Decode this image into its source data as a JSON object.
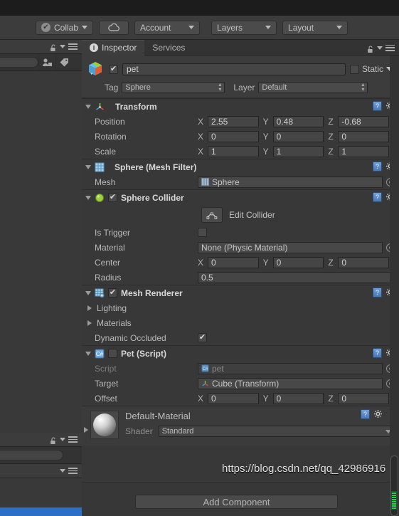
{
  "toolbar": {
    "collab_label": "Collab",
    "cloud_icon": "cloud-icon",
    "account_label": "Account",
    "layers_label": "Layers",
    "layout_label": "Layout"
  },
  "left_panel": {
    "lock_icon": "lock-icon",
    "menu_icon": "hamburger-menu-icon",
    "create_icon": "create-object-icon",
    "tag_icon": "tag-icon"
  },
  "inspector": {
    "tabs": [
      {
        "label": "Inspector",
        "icon": "info-icon",
        "active": true
      },
      {
        "label": "Services",
        "icon": "",
        "active": false
      }
    ],
    "lock_icon": "lock-icon",
    "menu_icon": "hamburger-menu-icon",
    "gameobject": {
      "icon": "cube-prefab-icon",
      "enabled": true,
      "name": "pet",
      "static_label": "Static",
      "static_checked": false,
      "tag_label": "Tag",
      "tag_value": "Sphere",
      "layer_label": "Layer",
      "layer_value": "Default"
    },
    "components": [
      {
        "name": "transform",
        "icon": "transform-axis-icon",
        "title": "Transform",
        "expanded": true,
        "has_toggle": false,
        "help_icon": "help-book-icon",
        "gear_icon": "gear-icon",
        "rows": [
          {
            "label": "Position",
            "type": "vector3",
            "x": "2.55",
            "y": "0.48",
            "z": "-0.68"
          },
          {
            "label": "Rotation",
            "type": "vector3",
            "x": "0",
            "y": "0",
            "z": "0"
          },
          {
            "label": "Scale",
            "type": "vector3",
            "x": "1",
            "y": "1",
            "z": "1"
          }
        ]
      },
      {
        "name": "mesh-filter",
        "icon": "mesh-filter-icon",
        "title": "Sphere (Mesh Filter)",
        "expanded": true,
        "has_toggle": false,
        "help_icon": "help-book-icon",
        "gear_icon": "gear-icon",
        "rows": [
          {
            "label": "Mesh",
            "type": "object",
            "value": "Sphere",
            "value_icon": "mesh-icon"
          }
        ]
      },
      {
        "name": "sphere-collider",
        "icon": "sphere-collider-icon",
        "title": "Sphere Collider",
        "expanded": true,
        "has_toggle": true,
        "toggle_checked": true,
        "help_icon": "help-book-icon",
        "gear_icon": "gear-icon",
        "edit_collider_label": "Edit Collider",
        "edit_collider_icon": "edit-collider-icon",
        "rows": [
          {
            "label": "Is Trigger",
            "type": "checkbox",
            "checked": false
          },
          {
            "label": "Material",
            "type": "object",
            "value": "None (Physic Material)"
          },
          {
            "label": "Center",
            "type": "vector3",
            "x": "0",
            "y": "0",
            "z": "0"
          },
          {
            "label": "Radius",
            "type": "number",
            "value": "0.5"
          }
        ]
      },
      {
        "name": "mesh-renderer",
        "icon": "mesh-renderer-icon",
        "title": "Mesh Renderer",
        "expanded": true,
        "has_toggle": true,
        "toggle_checked": true,
        "help_icon": "help-book-icon",
        "gear_icon": "gear-icon",
        "rows": [
          {
            "label": "Lighting",
            "type": "foldout"
          },
          {
            "label": "Materials",
            "type": "foldout"
          },
          {
            "label": "Dynamic Occluded",
            "type": "checkbox",
            "checked": true
          }
        ]
      },
      {
        "name": "pet-script",
        "icon": "cs-script-icon",
        "title": "Pet (Script)",
        "expanded": true,
        "has_toggle": true,
        "toggle_checked": false,
        "help_icon": "help-book-icon",
        "gear_icon": "gear-icon",
        "rows": [
          {
            "label": "Script",
            "type": "object",
            "value": "pet",
            "value_icon": "cs-script-icon",
            "dim": true
          },
          {
            "label": "Target",
            "type": "object",
            "value": "Cube (Transform)",
            "value_icon": "transform-axis-icon"
          },
          {
            "label": "Offset",
            "type": "vector3",
            "x": "0",
            "y": "0",
            "z": "0"
          }
        ]
      }
    ],
    "material_preview": {
      "name": "Default-Material",
      "shader_label": "Shader",
      "shader_value": "Standard",
      "help_icon": "help-book-icon",
      "gear_icon": "gear-icon",
      "preview_icon": "material-sphere-preview"
    },
    "add_component_label": "Add Component",
    "watermark": "https://blog.csdn.net/qq_42986916"
  },
  "colors": {
    "panel_bg": "#383838",
    "toolbar_bg": "#3c3c3c",
    "field_bg": "#454545",
    "text": "#c2c2c2",
    "accent_blue": "#2d6fc4",
    "scroll_green": "#27d24a"
  }
}
